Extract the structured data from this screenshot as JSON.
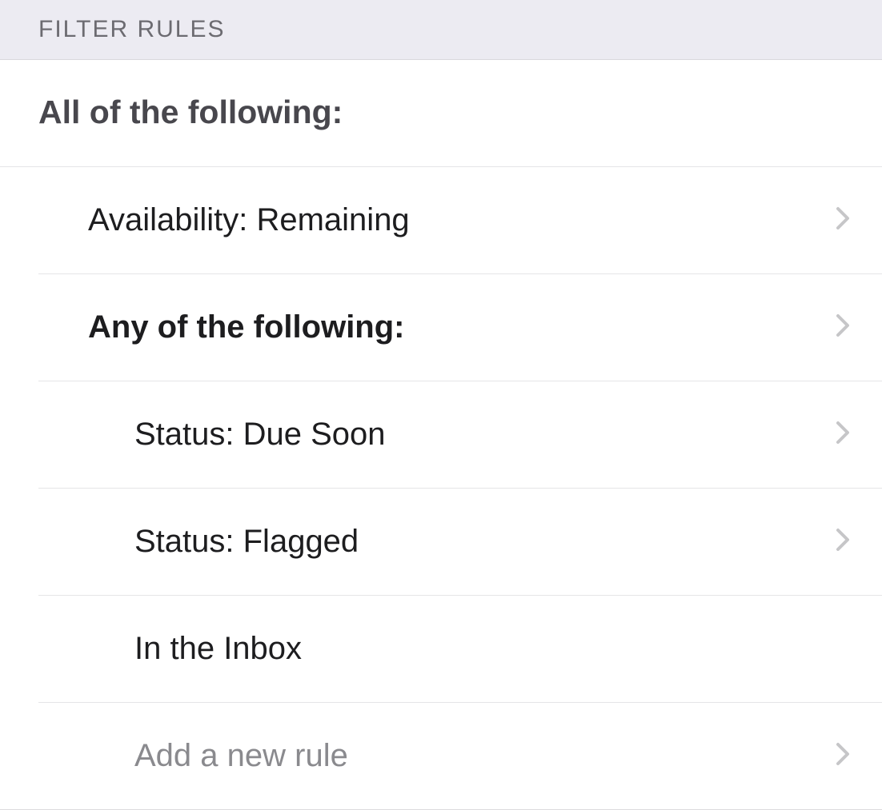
{
  "sectionHeader": "FILTER RULES",
  "groupHeader": "All of the following:",
  "rows": {
    "availability": "Availability: Remaining",
    "anyGroup": "Any of the following:",
    "statusDueSoon": "Status: Due Soon",
    "statusFlagged": "Status: Flagged",
    "inInbox": "In the Inbox",
    "addNew": "Add a new rule"
  }
}
